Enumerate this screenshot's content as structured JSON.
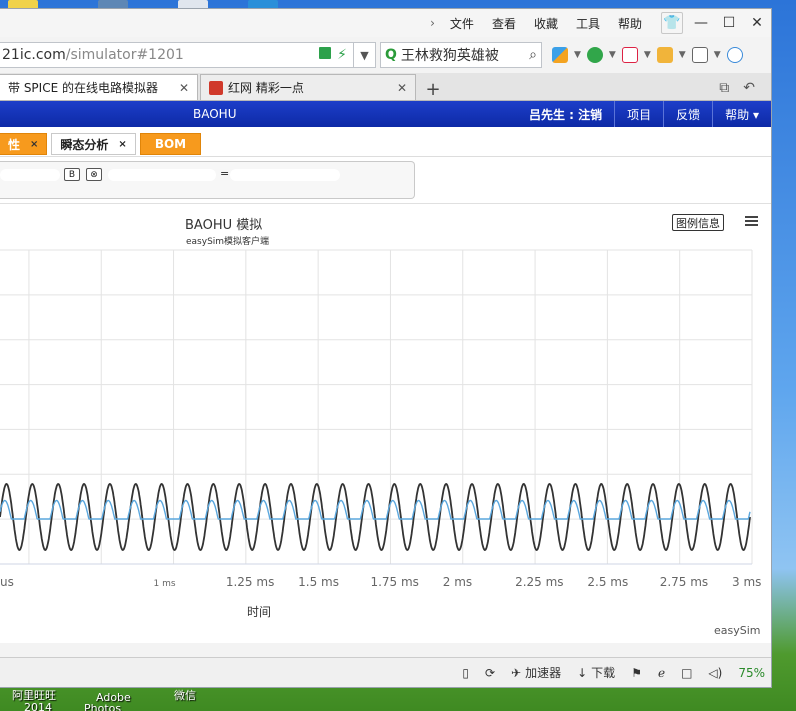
{
  "desktop": {
    "taskbar_labels": [
      "阿里旺旺",
      "2014",
      "Adobe",
      "Photos",
      "微信"
    ]
  },
  "browser": {
    "menu": [
      "文件",
      "查看",
      "收藏",
      "工具",
      "帮助"
    ],
    "url_main": "21ic.com",
    "url_path": "/simulator#1201",
    "search_text": "王林救狗英雄被",
    "tabs": [
      {
        "label": "带 SPICE 的在线电路模拟器",
        "active": true
      },
      {
        "label": "红网 精彩一点",
        "active": false
      }
    ]
  },
  "app": {
    "title": "BAOHU",
    "user": "吕先生 : 注销",
    "nav": [
      "项目",
      "反馈",
      "帮助 ▾"
    ],
    "subtabs": [
      {
        "label": "性",
        "style": "orange"
      },
      {
        "label": "瞬态分析",
        "style": "white"
      },
      {
        "label": "BOM",
        "style": "orange"
      }
    ],
    "control_buttons": [
      "B",
      "⊗"
    ],
    "control_eq": "="
  },
  "chart_data": {
    "type": "line",
    "title": "BAOHU 模拟",
    "subtitle": "easySim模拟客户端",
    "xlabel": "时间",
    "ylabel": "",
    "legend_button": "图例信息",
    "credit": "easySim",
    "x_ticks": [
      "us",
      "1 ms",
      "1.25 ms",
      "1.5 ms",
      "1.75 ms",
      "2 ms",
      "2.25 ms",
      "2.5 ms",
      "2.75 ms",
      "3 ms"
    ],
    "xlim": [
      0.4,
      3.0
    ],
    "cycles": 29,
    "series": [
      {
        "color": "#333333",
        "amplitude": 1.0
      },
      {
        "color": "#5aa7de",
        "amplitude": 0.35
      }
    ]
  },
  "statusbar": {
    "items": [
      "加速器",
      "下载"
    ],
    "zoom": "75%"
  }
}
